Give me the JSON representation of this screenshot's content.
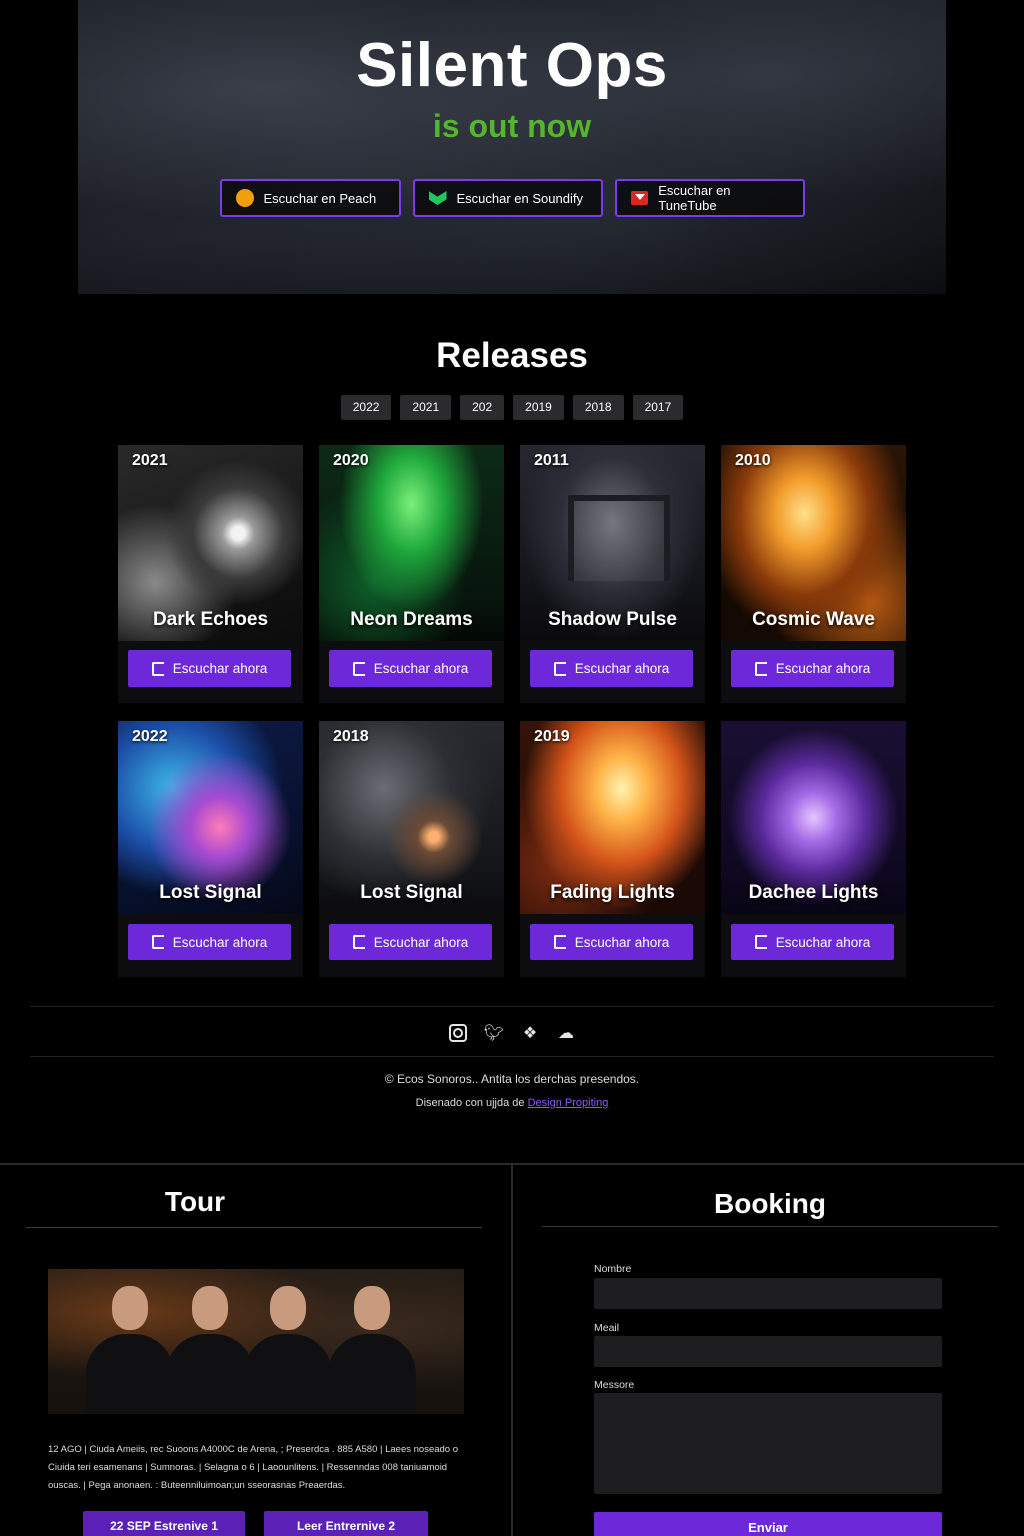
{
  "hero": {
    "title": "Silent Ops",
    "subtitle": "is out now",
    "subtitle_color": "#55b52c",
    "buttons": [
      {
        "label": "Escuchar en Peach",
        "icon": "peach-icon"
      },
      {
        "label": "Escuchar en Soundify",
        "icon": "soundify-icon"
      },
      {
        "label": "Escuchar en TuneTube",
        "icon": "tunetube-icon"
      }
    ]
  },
  "releases": {
    "title": "Releases",
    "years": [
      "2022",
      "2021",
      "202",
      "2019",
      "2018",
      "2017"
    ],
    "listen_label": "Escuchar ahora",
    "cards": [
      {
        "year": "2021",
        "title": "Dark Echoes"
      },
      {
        "year": "2020",
        "title": "Neon Dreams"
      },
      {
        "year": "2011",
        "title": "Shadow Pulse"
      },
      {
        "year": "2010",
        "title": "Cosmic Wave"
      },
      {
        "year": "2022",
        "title": "Lost Signal"
      },
      {
        "year": "2018",
        "title": "Lost Signal"
      },
      {
        "year": "2019",
        "title": "Fading Lights"
      },
      {
        "year": "",
        "title": "Dachee Lights"
      }
    ]
  },
  "footer": {
    "social": [
      "instagram-icon",
      "twitter-icon",
      "puzzle-icon",
      "cloud-icon"
    ],
    "copyright": "© Ecos Sonoros.. Antita los derchas presendos.",
    "credit_prefix": "Disenado con ujjda de",
    "credit_link": "Design Propiting"
  },
  "tour": {
    "title": "Tour",
    "text": "12 AGO | Ciuda Ameiis, rec Suoons A4000C de Arena, ; Preserdca . 885 A580 | Laees noseado o Ciuida teri esamenans | Sumnoras. | Selagna o 6 | Laoounlitens. | Ressenndas 008 taniuamoid ouscas. | Pega anonaen. : Buteenniluimoan;un sseorasnas Preaerdas.",
    "btn1": "22 SEP Estrenive 1",
    "btn2": "Leer Entrernive 2"
  },
  "booking": {
    "title": "Booking",
    "name_label": "Nombre",
    "email_label": "Meail",
    "message_label": "Messore",
    "submit": "Enviar"
  },
  "colors": {
    "accent": "#6d28d9",
    "background": "#000000"
  }
}
